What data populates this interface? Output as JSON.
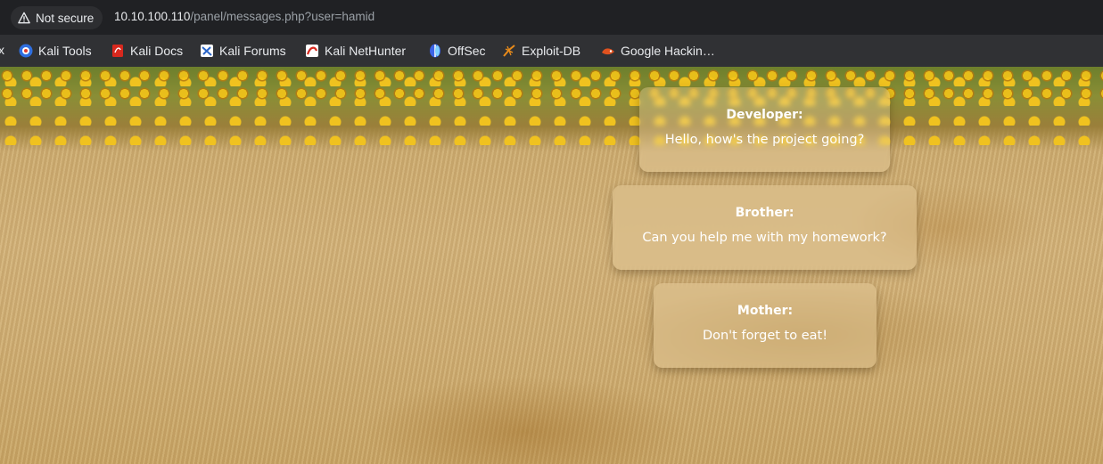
{
  "browser": {
    "security_label": "Not secure",
    "url_host": "10.10.100.110",
    "url_path": "/panel/messages.php?user=hamid"
  },
  "bookmarks": {
    "lead": "x",
    "items": [
      {
        "label": "Kali Tools",
        "icon": "kali-tools-icon"
      },
      {
        "label": "Kali Docs",
        "icon": "kali-docs-icon"
      },
      {
        "label": "Kali Forums",
        "icon": "kali-forums-icon"
      },
      {
        "label": "Kali NetHunter",
        "icon": "kali-nethunter-icon"
      },
      {
        "label": "OffSec",
        "icon": "offsec-icon"
      },
      {
        "label": "Exploit-DB",
        "icon": "exploit-db-icon"
      },
      {
        "label": "Google Hackin…",
        "icon": "google-hacking-icon"
      }
    ]
  },
  "messages": [
    {
      "sender": "Developer:",
      "text": "Hello, how's the project going?"
    },
    {
      "sender": "Brother:",
      "text": "Can you help me with my homework?"
    },
    {
      "sender": "Mother:",
      "text": "Don't forget to eat!"
    }
  ]
}
